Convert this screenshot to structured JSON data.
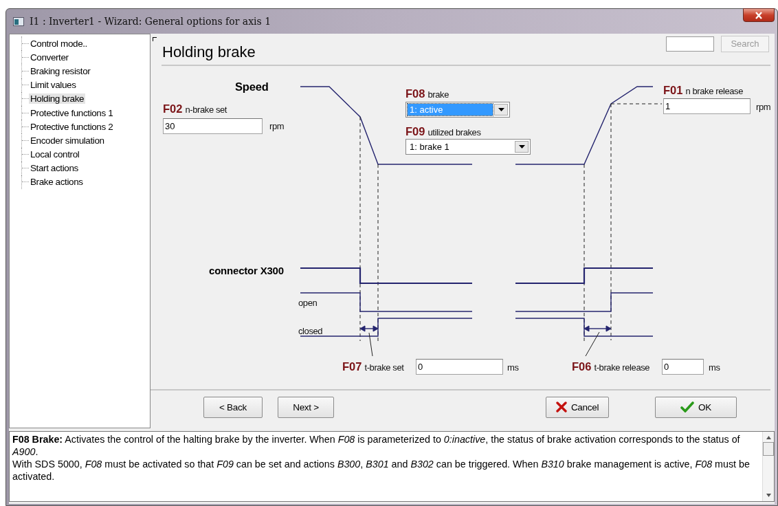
{
  "window": {
    "title": "I1 : Inverter1 - Wizard: General options for axis 1"
  },
  "sidebar": {
    "items": [
      {
        "label": "Control mode..",
        "selected": false
      },
      {
        "label": "Converter",
        "selected": false
      },
      {
        "label": "Braking resistor",
        "selected": false
      },
      {
        "label": "Limit values",
        "selected": false
      },
      {
        "label": "Holding brake",
        "selected": true
      },
      {
        "label": "Protective functions 1",
        "selected": false
      },
      {
        "label": "Protective functions 2",
        "selected": false
      },
      {
        "label": "Encoder simulation",
        "selected": false
      },
      {
        "label": "Local control",
        "selected": false
      },
      {
        "label": "Start actions",
        "selected": false
      },
      {
        "label": "Brake actions",
        "selected": false
      }
    ]
  },
  "page": {
    "heading": "Holding brake",
    "search_button": {
      "label": "Search",
      "disabled": true
    }
  },
  "diagram": {
    "speed_label": "Speed",
    "connector_label": "connector X300",
    "open_label": "open",
    "closed_label": "closed",
    "f02": {
      "code": "F02",
      "label": "n-brake set",
      "value": "30",
      "unit": "rpm"
    },
    "f08": {
      "code": "F08",
      "label": "brake",
      "value": "1:  active",
      "focused": true
    },
    "f09": {
      "code": "F09",
      "label": "utilized brakes",
      "value": "1: brake 1",
      "focused": false
    },
    "f01": {
      "code": "F01",
      "label": "n brake release",
      "value": "1",
      "unit": "rpm"
    },
    "f07": {
      "code": "F07",
      "label": "t-brake set",
      "value": "0",
      "unit": "ms"
    },
    "f06": {
      "code": "F06",
      "label": "t-brake release",
      "value": "0",
      "unit": "ms"
    }
  },
  "buttons": [
    {
      "label": "< Back",
      "kind": "back"
    },
    {
      "label": "Next >",
      "kind": "next"
    },
    {
      "label": "Cancel",
      "kind": "cancel"
    },
    {
      "label": "OK",
      "kind": "ok"
    }
  ],
  "help": {
    "paragraphs": [
      "**F08 Brake:** Activates the control of the halting brake by the inverter. When *F08* is parameterized to *0:inactive*, the status of brake activation corresponds to the status of *A900*.",
      "With SDS 5000, *F08* must be activated so that *F09* can be set and actions *B300*, *B301* and *B302* can be triggered. When *B310* brake management is active, *F08* must be activated."
    ]
  }
}
